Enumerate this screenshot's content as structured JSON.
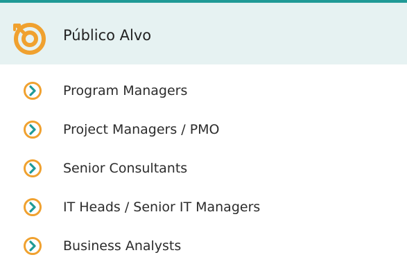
{
  "colors": {
    "accent_teal": "#1f9a96",
    "header_bg": "#e6f2f2",
    "icon_orange": "#f0a12f",
    "chevron_teal": "#1f9a96"
  },
  "header": {
    "icon": "target-icon",
    "title": "Público Alvo"
  },
  "list": {
    "bullet_icon": "chevron-right-circle-icon",
    "items": [
      {
        "label": "Program Managers"
      },
      {
        "label": "Project Managers / PMO"
      },
      {
        "label": "Senior Consultants"
      },
      {
        "label": "IT Heads / Senior IT Managers"
      },
      {
        "label": "Business Analysts"
      }
    ]
  }
}
